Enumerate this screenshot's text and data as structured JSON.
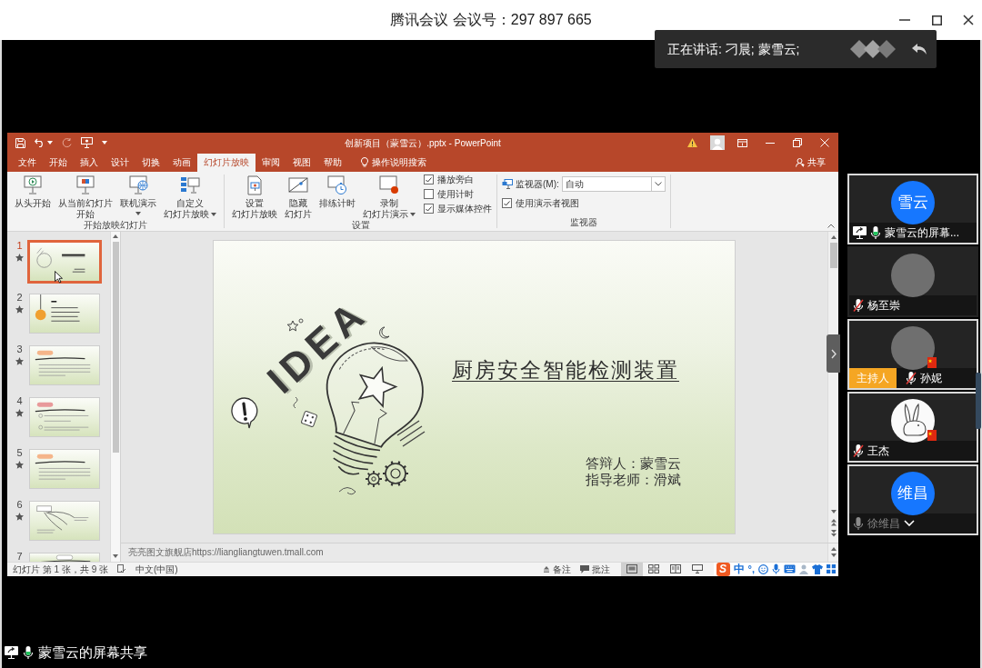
{
  "meeting_header": {
    "title": "腾讯会议 会议号：297 897 665"
  },
  "speaking_banner": {
    "text": "正在讲话: 刁晨; 蒙雪云;"
  },
  "powerpoint": {
    "title": "创新项目（蒙雪云）.pptx - PowerPoint",
    "tabs": [
      {
        "label": "文件",
        "selected": false
      },
      {
        "label": "开始",
        "selected": false
      },
      {
        "label": "插入",
        "selected": false
      },
      {
        "label": "设计",
        "selected": false
      },
      {
        "label": "切换",
        "selected": false
      },
      {
        "label": "动画",
        "selected": false
      },
      {
        "label": "幻灯片放映",
        "selected": true
      },
      {
        "label": "审阅",
        "selected": false
      },
      {
        "label": "视图",
        "selected": false
      },
      {
        "label": "帮助",
        "selected": false
      }
    ],
    "tell_me": "操作说明搜索",
    "share": "共享",
    "ribbon_groups": [
      {
        "label": "开始放映幻灯片",
        "controls": [
          {
            "kind": "large",
            "lines": [
              "从头开始"
            ],
            "dropdown": false
          },
          {
            "kind": "large",
            "lines": [
              "从当前幻灯片",
              "开始"
            ],
            "dropdown": false
          },
          {
            "kind": "large",
            "lines": [
              "联机演示"
            ],
            "dropdown": true
          },
          {
            "kind": "large",
            "lines": [
              "自定义",
              "幻灯片放映"
            ],
            "dropdown": true
          }
        ]
      },
      {
        "label": "设置",
        "controls": [
          {
            "kind": "large",
            "lines": [
              "设置",
              "幻灯片放映"
            ],
            "dropdown": false
          },
          {
            "kind": "large",
            "lines": [
              "隐藏",
              "幻灯片"
            ],
            "dropdown": false
          },
          {
            "kind": "large",
            "lines": [
              "排练计时"
            ],
            "dropdown": false
          },
          {
            "kind": "large",
            "lines": [
              "录制",
              "幻灯片演示"
            ],
            "dropdown": true
          },
          {
            "kind": "checks",
            "items": [
              {
                "label": "播放旁白",
                "checked": true
              },
              {
                "label": "使用计时",
                "checked": false
              },
              {
                "label": "显示媒体控件",
                "checked": true
              }
            ]
          }
        ]
      },
      {
        "label": "监视器",
        "controls": [
          {
            "kind": "select",
            "label": "监视器(M):",
            "value": "自动"
          },
          {
            "kind": "check",
            "label": "使用演示者视图",
            "checked": true
          }
        ]
      }
    ],
    "slides": [
      {
        "number": "1",
        "selected": true,
        "has_animation": true,
        "kind": "title"
      },
      {
        "number": "2",
        "selected": false,
        "has_animation": true,
        "kind": "agenda"
      },
      {
        "number": "3",
        "selected": false,
        "has_animation": true,
        "kind": "text"
      },
      {
        "number": "4",
        "selected": false,
        "has_animation": true,
        "kind": "list"
      },
      {
        "number": "5",
        "selected": false,
        "has_animation": true,
        "kind": "text"
      },
      {
        "number": "6",
        "selected": false,
        "has_animation": true,
        "kind": "diagram"
      },
      {
        "number": "7",
        "selected": false,
        "has_animation": false,
        "kind": "heading"
      }
    ],
    "slide": {
      "title": "厨房安全智能检测装置",
      "artwork_text": "IDEA",
      "presenter_lines": [
        "答辩人：蒙雪云",
        "指导老师：滑斌"
      ]
    },
    "notes": "亮亮图文旗舰店https://liangliangtuwen.tmall.com",
    "status_bar": {
      "slide_info": "幻灯片 第 1 张，共 9 张",
      "language": "中文(中国)",
      "notes_button": "备注",
      "comments_button": "批注",
      "views": [
        {
          "kind": "normal",
          "selected": true
        },
        {
          "kind": "sorter",
          "selected": false
        },
        {
          "kind": "reading",
          "selected": false
        },
        {
          "kind": "slideshow",
          "selected": false
        }
      ]
    }
  },
  "ime_toolbar": {
    "logo": "S",
    "mode": "中",
    "punctuation": "°,"
  },
  "participants": [
    {
      "name": "蒙雪云的屏幕...",
      "avatar": {
        "kind": "initials",
        "text": "雪云"
      },
      "mic": {
        "kind": "active"
      },
      "sharing": true,
      "outlined": true,
      "dimmed": false,
      "flag_badge": false,
      "chevron": false
    },
    {
      "name": "杨至崇",
      "avatar": {
        "kind": "photo"
      },
      "mic": {
        "kind": "muted"
      },
      "sharing": false,
      "outlined": false,
      "dimmed": false,
      "flag_badge": false,
      "chevron": false
    },
    {
      "name": "孙妮",
      "avatar": {
        "kind": "photo"
      },
      "host_badge": "主持人",
      "mic": {
        "kind": "muted"
      },
      "sharing": false,
      "outlined": true,
      "dimmed": false,
      "flag_badge": true,
      "chevron": false
    },
    {
      "name": "王杰",
      "avatar": {
        "kind": "drawing"
      },
      "mic": {
        "kind": "muted"
      },
      "sharing": false,
      "outlined": true,
      "dimmed": false,
      "flag_badge": true,
      "chevron": false
    },
    {
      "name": "徐维昌",
      "avatar": {
        "kind": "initials",
        "text": "维昌"
      },
      "mic": {
        "kind": "idle"
      },
      "sharing": false,
      "outlined": true,
      "dimmed": true,
      "flag_badge": false,
      "chevron": true
    }
  ],
  "screen_share_label": {
    "text": "蒙雪云的屏幕共享"
  }
}
